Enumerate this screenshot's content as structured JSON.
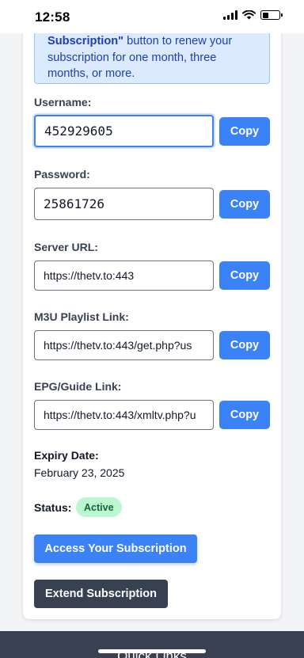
{
  "status_bar": {
    "time": "12:58"
  },
  "notice": {
    "line1_bold": "Subscription\"",
    "line1_rest": " button to renew your",
    "line2": "subscription for one month, three",
    "line3": "months, or more."
  },
  "fields": {
    "username": {
      "label": "Username:",
      "value": "452929605",
      "copy_label": "Copy"
    },
    "password": {
      "label": "Password:",
      "value": "25861726",
      "copy_label": "Copy"
    },
    "server_url": {
      "label": "Server URL:",
      "value": "https://thetv.to:443",
      "copy_label": "Copy"
    },
    "m3u": {
      "label": "M3U Playlist Link:",
      "value": "https://thetv.to:443/get.php?us",
      "copy_label": "Copy"
    },
    "epg": {
      "label": "EPG/Guide Link:",
      "value": "https://thetv.to:443/xmltv.php?u",
      "copy_label": "Copy"
    }
  },
  "expiry": {
    "label": "Expiry Date:",
    "value": "February 23, 2025"
  },
  "status": {
    "label": "Status:",
    "badge": "Active"
  },
  "actions": {
    "access": "Access Your Subscription",
    "extend": "Extend Subscription"
  },
  "footer": {
    "title": "Quick Links"
  },
  "colors": {
    "primary": "#3b82f6",
    "dark": "#374151",
    "active_bg": "#bbf7d0",
    "active_text": "#166534",
    "notice_bg": "#dbeafe"
  }
}
